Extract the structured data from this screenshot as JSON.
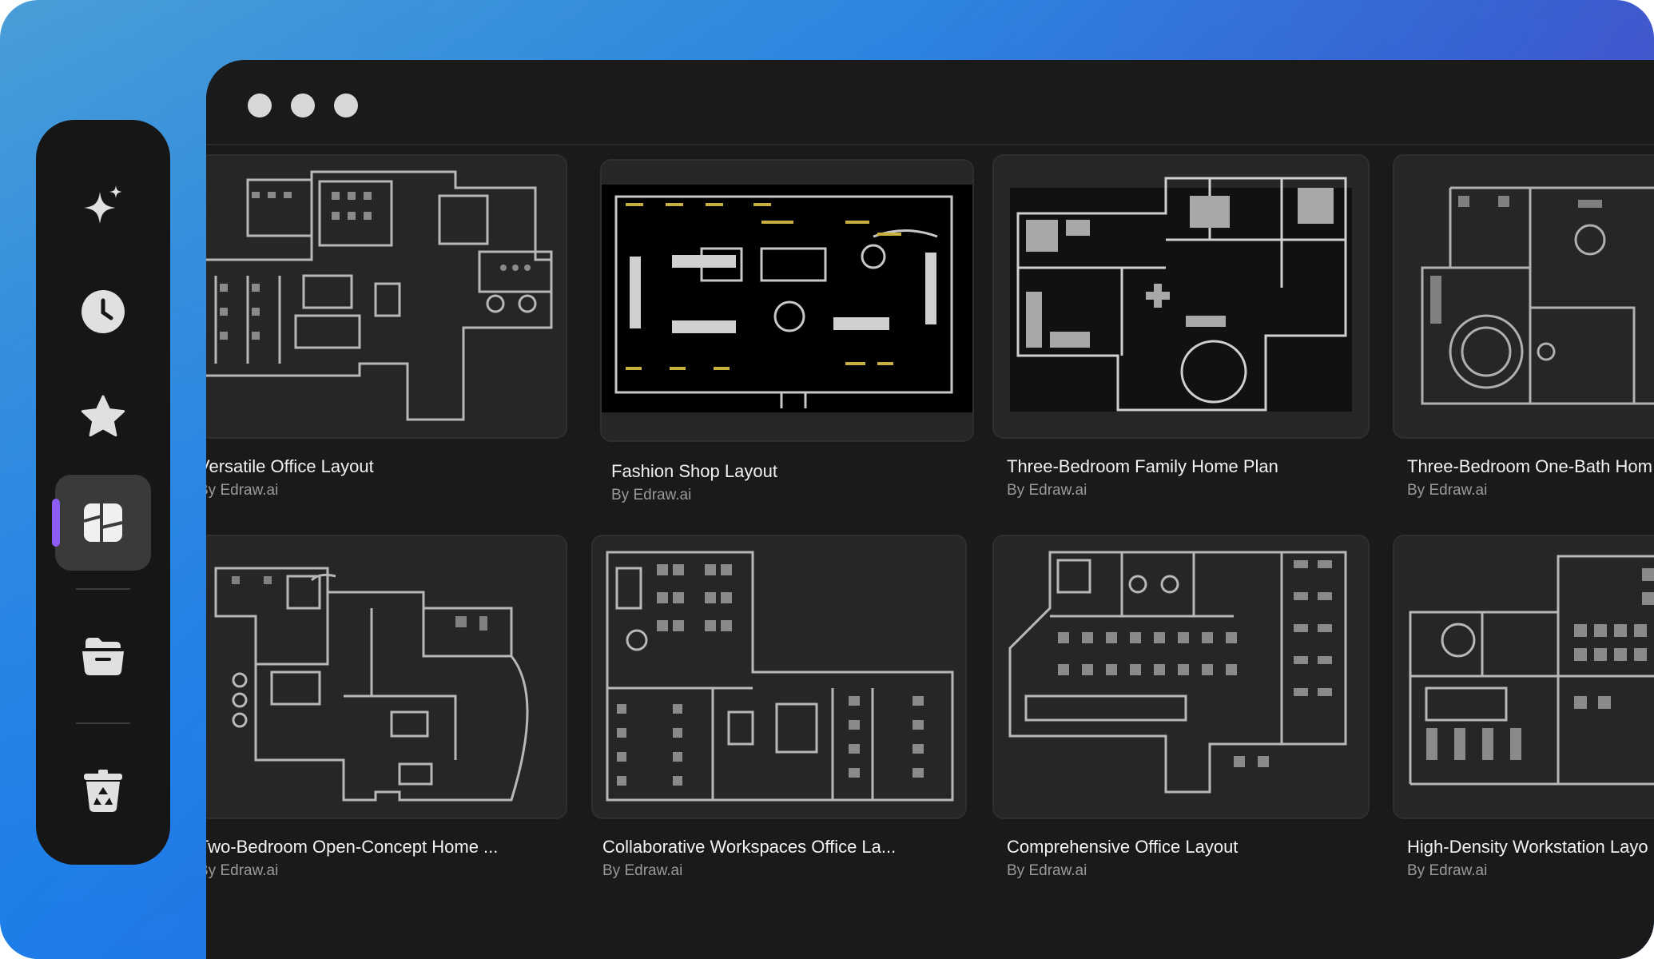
{
  "sidebar": {
    "items": [
      {
        "name": "ai-sparkle-icon"
      },
      {
        "name": "recent-clock-icon"
      },
      {
        "name": "favorites-star-icon"
      },
      {
        "name": "templates-icon",
        "active": true
      },
      {
        "name": "folder-icon"
      },
      {
        "name": "recycle-bin-icon"
      }
    ],
    "accent": "#8b5cf6"
  },
  "templates": [
    {
      "title": "Versatile Office Layout",
      "author": "By Edraw.ai"
    },
    {
      "title": "Fashion Shop Layout",
      "author": "By Edraw.ai"
    },
    {
      "title": "Three-Bedroom Family Home Plan",
      "author": "By Edraw.ai"
    },
    {
      "title": "Three-Bedroom One-Bath Hom",
      "author": "By Edraw.ai"
    },
    {
      "title": "Two-Bedroom Open-Concept Home ...",
      "author": "By Edraw.ai"
    },
    {
      "title": "Collaborative Workspaces Office La...",
      "author": "By Edraw.ai"
    },
    {
      "title": "Comprehensive Office Layout",
      "author": "By Edraw.ai"
    },
    {
      "title": "High-Density Workstation Layo",
      "author": "By Edraw.ai"
    }
  ]
}
